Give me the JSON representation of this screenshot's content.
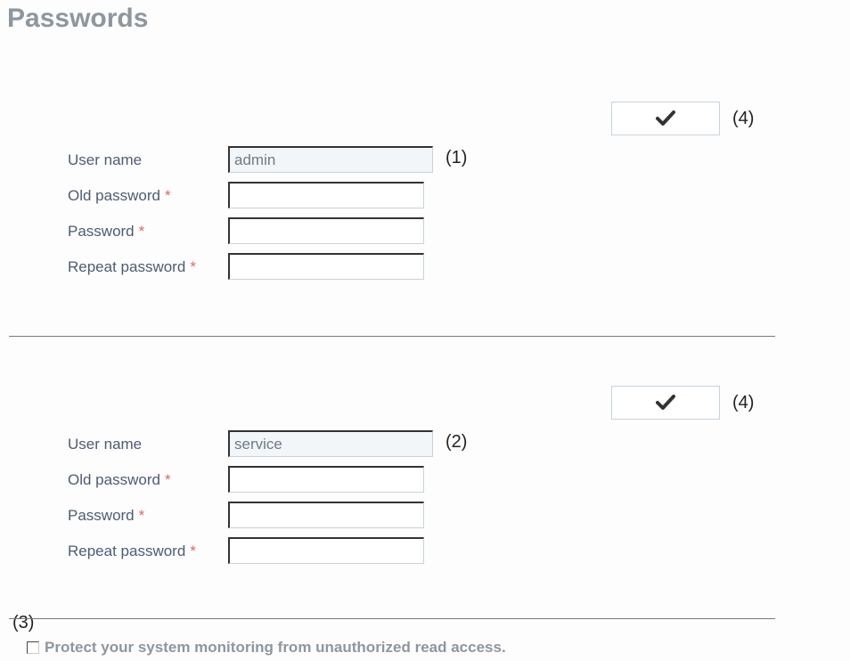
{
  "page": {
    "title": "Passwords"
  },
  "sections": [
    {
      "confirm_icon": "checkmark-icon",
      "confirm_marker": "(4)",
      "field_marker": "(1)",
      "fields": {
        "username_label": "User name",
        "username_value": "admin",
        "old_password_label": "Old password",
        "password_label": "Password",
        "repeat_password_label": "Repeat password",
        "required_mark": "*"
      }
    },
    {
      "confirm_icon": "checkmark-icon",
      "confirm_marker": "(4)",
      "field_marker": "(2)",
      "fields": {
        "username_label": "User name",
        "username_value": "service",
        "old_password_label": "Old password",
        "password_label": "Password",
        "repeat_password_label": "Repeat password",
        "required_mark": "*"
      }
    }
  ],
  "protect": {
    "marker": "(3)",
    "label": "Protect your system monitoring from unauthorized read access.",
    "checked": false
  },
  "colors": {
    "title": "#8e969e",
    "label": "#4e5c72",
    "required": "#e06666",
    "divider": "#7a7a7a"
  }
}
